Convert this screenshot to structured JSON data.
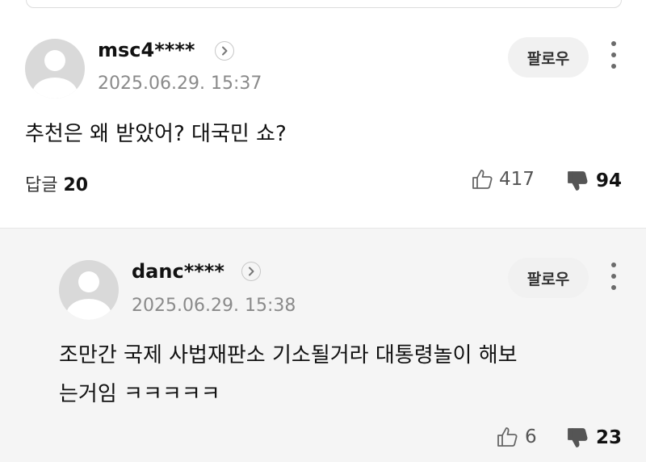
{
  "comment": {
    "username": "msc4****",
    "timestamp": "2025.06.29. 15:37",
    "follow_label": "팔로우",
    "text": "추천은 왜 받았어? 대국민 쇼?",
    "replies_label": "답글",
    "replies_count": "20",
    "likes": "417",
    "dislikes": "94"
  },
  "reply": {
    "username": "danc****",
    "timestamp": "2025.06.29. 15:38",
    "follow_label": "팔로우",
    "text_line1": "조만간 국제 사법재판소 기소될거라 대통령놀이 해보",
    "text_line2": "는거임 ㅋㅋㅋㅋㅋ",
    "likes": "6",
    "dislikes": "23"
  },
  "icons": {
    "avatar": "default-user-icon",
    "profile_link": "chevron-right-icon",
    "more": "more-vertical-icon",
    "like": "thumbs-up-icon",
    "dislike": "thumbs-down-icon"
  },
  "colors": {
    "muted_text": "#8a8a8a",
    "follow_bg": "#f1f1f1",
    "reply_bg": "#f5f5f5",
    "avatar_bg": "#d9d9d9"
  }
}
